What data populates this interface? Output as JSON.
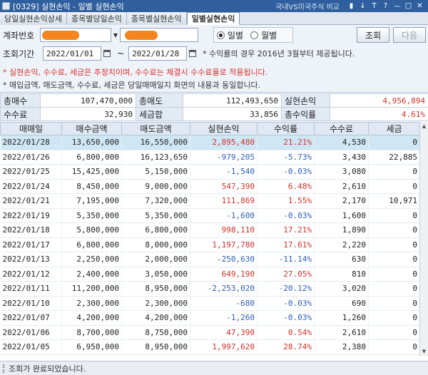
{
  "window": {
    "title": "[0329] 실현손익 - 일별 실현손익",
    "right_link": "국내VS미국주식 비교",
    "controls": [
      "▮",
      "↓",
      "T",
      "?",
      "ㅡ",
      "□",
      "✕"
    ]
  },
  "tabs": [
    {
      "label": "당일실현손익상세",
      "active": false
    },
    {
      "label": "종목별당일손익",
      "active": false
    },
    {
      "label": "종목별실현손익",
      "active": false
    },
    {
      "label": "일별실현손익",
      "active": true
    }
  ],
  "search": {
    "account_label": "계좌번호",
    "period_label": "조회기간",
    "start_date": "2022/01/01",
    "end_date": "2022/01/28",
    "tilde": "~",
    "radio_daily": "일별",
    "radio_monthly": "월별",
    "search_button": "조회",
    "next_button": "다음",
    "note_since": "* 수익률의 경우 2016년 3월부터 제공됩니다.",
    "note_estimate": "* 실현손익, 수수료, 세금은 추정치이며, 수수료는 체결시 수수료율로 적용됩니다.",
    "note_amount": "* 매입금액, 매도금액, 수수료, 세금은 당일매매일지 화면의 내용과 동일합니다."
  },
  "summary": {
    "total_buy_label": "총매수",
    "total_buy": "107,470,000",
    "total_sell_label": "총매도",
    "total_sell": "112,493,650",
    "realized_label": "실현손익",
    "realized": "4,956,894",
    "fee_label": "수수료",
    "fee": "32,930",
    "tax_label": "세금합",
    "tax": "33,856",
    "return_label": "총수익률",
    "return": "4.61%"
  },
  "table": {
    "columns": [
      "매매일",
      "매수금액",
      "매도금액",
      "실현손익",
      "수익률",
      "수수료",
      "세금"
    ],
    "rows": [
      {
        "date": "2022/01/28",
        "buy": "13,650,000",
        "sell": "16,550,000",
        "pnl": "2,895,480",
        "rate": "21.21%",
        "fee": "4,530",
        "tax": "0",
        "sign": "pos"
      },
      {
        "date": "2022/01/26",
        "buy": "6,800,000",
        "sell": "16,123,650",
        "pnl": "-979,205",
        "rate": "-5.73%",
        "fee": "3,430",
        "tax": "22,885",
        "sign": "neg"
      },
      {
        "date": "2022/01/25",
        "buy": "15,425,000",
        "sell": "5,150,000",
        "pnl": "-1,540",
        "rate": "-0.03%",
        "fee": "3,080",
        "tax": "0",
        "sign": "neg"
      },
      {
        "date": "2022/01/24",
        "buy": "8,450,000",
        "sell": "9,000,000",
        "pnl": "547,390",
        "rate": "6.48%",
        "fee": "2,610",
        "tax": "0",
        "sign": "pos"
      },
      {
        "date": "2022/01/21",
        "buy": "7,195,000",
        "sell": "7,320,000",
        "pnl": "111,869",
        "rate": "1.55%",
        "fee": "2,170",
        "tax": "10,971",
        "sign": "pos"
      },
      {
        "date": "2022/01/19",
        "buy": "5,350,000",
        "sell": "5,350,000",
        "pnl": "-1,600",
        "rate": "-0.03%",
        "fee": "1,600",
        "tax": "0",
        "sign": "neg"
      },
      {
        "date": "2022/01/18",
        "buy": "5,800,000",
        "sell": "6,800,000",
        "pnl": "998,110",
        "rate": "17.21%",
        "fee": "1,890",
        "tax": "0",
        "sign": "pos"
      },
      {
        "date": "2022/01/17",
        "buy": "6,800,000",
        "sell": "8,000,000",
        "pnl": "1,197,780",
        "rate": "17.61%",
        "fee": "2,220",
        "tax": "0",
        "sign": "pos"
      },
      {
        "date": "2022/01/13",
        "buy": "2,250,000",
        "sell": "2,000,000",
        "pnl": "-250,630",
        "rate": "-11.14%",
        "fee": "630",
        "tax": "0",
        "sign": "neg"
      },
      {
        "date": "2022/01/12",
        "buy": "2,400,000",
        "sell": "3,050,000",
        "pnl": "649,190",
        "rate": "27.05%",
        "fee": "810",
        "tax": "0",
        "sign": "pos"
      },
      {
        "date": "2022/01/11",
        "buy": "11,200,000",
        "sell": "8,950,000",
        "pnl": "-2,253,020",
        "rate": "-20.12%",
        "fee": "3,020",
        "tax": "0",
        "sign": "neg"
      },
      {
        "date": "2022/01/10",
        "buy": "2,300,000",
        "sell": "2,300,000",
        "pnl": "-680",
        "rate": "-0.03%",
        "fee": "690",
        "tax": "0",
        "sign": "neg"
      },
      {
        "date": "2022/01/07",
        "buy": "4,200,000",
        "sell": "4,200,000",
        "pnl": "-1,260",
        "rate": "-0.03%",
        "fee": "1,260",
        "tax": "0",
        "sign": "neg"
      },
      {
        "date": "2022/01/06",
        "buy": "8,700,000",
        "sell": "8,750,000",
        "pnl": "47,390",
        "rate": "0.54%",
        "fee": "2,610",
        "tax": "0",
        "sign": "pos"
      },
      {
        "date": "2022/01/05",
        "buy": "6,950,000",
        "sell": "8,950,000",
        "pnl": "1,997,620",
        "rate": "28.74%",
        "fee": "2,380",
        "tax": "0",
        "sign": "pos"
      }
    ]
  },
  "status": {
    "text": "조회가 완료되었습니다."
  },
  "colors": {
    "positive": "#d0322b",
    "negative": "#2c5dbb",
    "selected_row": "#cfe6f4",
    "mask": "#f5861f",
    "title_bar": "#2f5f9e"
  }
}
